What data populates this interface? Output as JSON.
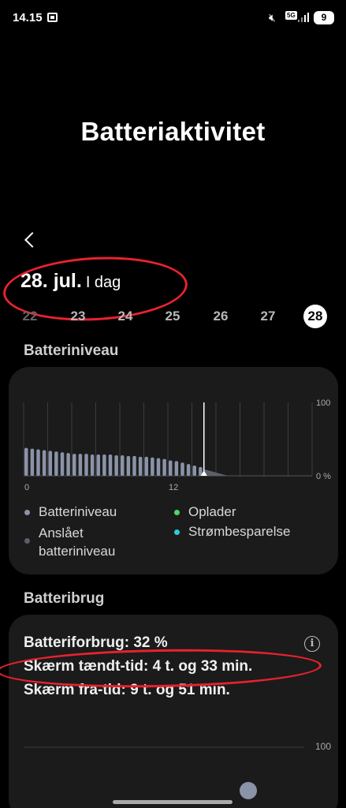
{
  "status_bar": {
    "time": "14.15",
    "network": "5G",
    "battery_level": "9",
    "icons": [
      "screenshot-icon",
      "mute-icon",
      "signal-icon"
    ]
  },
  "page": {
    "title": "Batteriaktivitet",
    "back_icon": "chevron-left-icon"
  },
  "date": {
    "main": "28. jul.",
    "sub": "I dag"
  },
  "days": [
    {
      "label": "22",
      "active": false
    },
    {
      "label": "23",
      "active": false
    },
    {
      "label": "24",
      "active": false
    },
    {
      "label": "25",
      "active": false
    },
    {
      "label": "26",
      "active": false
    },
    {
      "label": "27",
      "active": false
    },
    {
      "label": "28",
      "active": true
    }
  ],
  "battery_level_section": {
    "title": "Batteriniveau",
    "y_max_label": "100",
    "y_min_label": "0 %",
    "x_labels": [
      "0",
      "12"
    ],
    "legend": [
      {
        "label": "Batteriniveau",
        "color": "#8a93a8"
      },
      {
        "label": "Oplader",
        "color": "#4cd964"
      },
      {
        "label": "Anslået batteriniveau",
        "color": "#5a5f6a"
      },
      {
        "label": "Strømbesparelse",
        "color": "#33c8d8"
      }
    ]
  },
  "chart_data": {
    "type": "bar",
    "title": "Batteriniveau",
    "xlabel": "",
    "ylabel": "",
    "x_tick_labels": [
      "0",
      "12"
    ],
    "y_tick_labels": [
      "100",
      "0 %"
    ],
    "ylim": [
      0,
      100
    ],
    "grid": true,
    "current_hour": 15,
    "series": [
      {
        "name": "Batteriniveau",
        "color": "#8a93a8",
        "hours": [
          0,
          0.5,
          1,
          1.5,
          2,
          2.5,
          3,
          3.5,
          4,
          4.5,
          5,
          5.5,
          6,
          6.5,
          7,
          7.5,
          8,
          8.5,
          9,
          9.5,
          10,
          10.5,
          11,
          11.5,
          12,
          12.5,
          13,
          13.5,
          14,
          14.5
        ],
        "values": [
          38,
          37,
          36,
          35,
          34,
          33,
          32,
          31,
          30,
          30,
          30,
          29,
          29,
          29,
          29,
          28,
          28,
          27,
          27,
          26,
          26,
          25,
          24,
          23,
          21,
          20,
          18,
          16,
          14,
          12
        ]
      },
      {
        "name": "Anslået batteriniveau",
        "color": "#5a5f6a",
        "hours": [
          15,
          17
        ],
        "values": [
          9,
          0
        ]
      }
    ]
  },
  "battery_usage_section": {
    "title": "Batteribrug",
    "consumption": "Batteriforbrug: 32 %",
    "screen_on": "Skærm tændt-tid: 4 t. og 33 min.",
    "screen_off": "Skærm fra-tid: 9 t. og 51 min.",
    "chart_max_label": "100",
    "info_icon": "info-icon"
  },
  "colors": {
    "background": "#000000",
    "card": "#1b1b1b",
    "annotation": "#e8222e",
    "accent_white": "#ffffff"
  }
}
